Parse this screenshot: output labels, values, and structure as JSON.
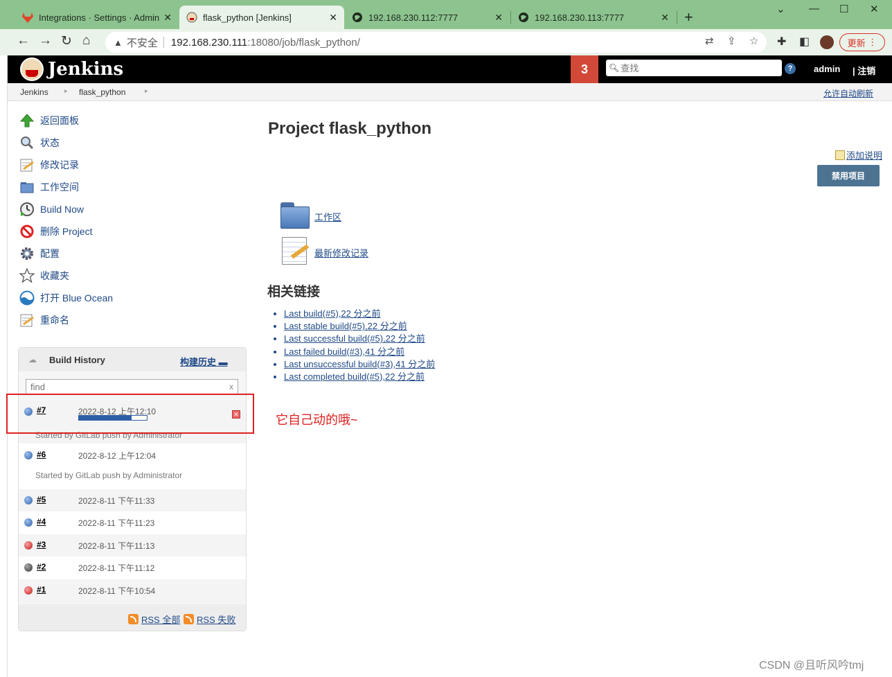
{
  "browser": {
    "tabs": [
      {
        "title": "Integrations · Settings · Admin",
        "icon": "gitlab-icon",
        "active": false
      },
      {
        "title": "flask_python [Jenkins]",
        "icon": "jenkins-icon",
        "active": true
      },
      {
        "title": "192.168.230.112:7777",
        "icon": "globe-icon",
        "active": false
      },
      {
        "title": "192.168.230.113:7777",
        "icon": "globe-icon",
        "active": false
      }
    ],
    "new_tab": "+",
    "address": {
      "security_label": "不安全",
      "host": "192.168.230.111",
      "path": ":18080/job/flask_python/"
    },
    "update_label": "更新"
  },
  "jenkins": {
    "brand": "Jenkins",
    "notifications": "3",
    "search_placeholder": "查找",
    "help": "?",
    "user": "admin",
    "logout": "| 注销",
    "breadcrumbs": [
      "Jenkins",
      "flask_python"
    ],
    "auto_refresh": "允许自动刷新"
  },
  "sidebar": {
    "tasks": [
      {
        "label": "返回面板",
        "icon": "up-arrow-icon"
      },
      {
        "label": "状态",
        "icon": "search-icon"
      },
      {
        "label": "修改记录",
        "icon": "notepad-icon"
      },
      {
        "label": "工作空间",
        "icon": "folder-icon"
      },
      {
        "label": "Build Now",
        "icon": "clock-icon"
      },
      {
        "label": "删除 Project",
        "icon": "no-entry-icon"
      },
      {
        "label": "配置",
        "icon": "gear-icon"
      },
      {
        "label": "收藏夹",
        "icon": "star-icon"
      },
      {
        "label": "打开 Blue Ocean",
        "icon": "blue-ocean-icon"
      },
      {
        "label": "重命名",
        "icon": "notepad-icon"
      }
    ]
  },
  "build_history": {
    "title": "Build History",
    "trend_link": "构建历史 ▬",
    "find_placeholder": "find",
    "find_clear": "x",
    "builds": [
      {
        "num": "#7",
        "date": "2022-8-12 上午12:10",
        "status": "blue",
        "cause": "Started by GitLab push by Administrator",
        "in_progress": true,
        "progress": 0.78
      },
      {
        "num": "#6",
        "date": "2022-8-12 上午12:04",
        "status": "blue",
        "cause": "Started by GitLab push by Administrator"
      },
      {
        "num": "#5",
        "date": "2022-8-11 下午11:33",
        "status": "blue"
      },
      {
        "num": "#4",
        "date": "2022-8-11 下午11:23",
        "status": "blue"
      },
      {
        "num": "#3",
        "date": "2022-8-11 下午11:13",
        "status": "red"
      },
      {
        "num": "#2",
        "date": "2022-8-11 下午11:12",
        "status": "grey"
      },
      {
        "num": "#1",
        "date": "2022-8-11 下午10:54",
        "status": "red"
      }
    ],
    "rss_all": "RSS 全部",
    "rss_failed": "RSS 失败"
  },
  "annotation": "它自己动的哦~",
  "main": {
    "title": "Project flask_python",
    "add_description": "添加说明",
    "disable_button": "禁用项目",
    "workspace_link": "工作区",
    "changes_link": "最新修改记录",
    "related_heading": "相关链接",
    "related_links": [
      "Last build(#5),22 分之前",
      "Last stable build(#5),22 分之前",
      "Last successful build(#5),22 分之前",
      "Last failed build(#3),41 分之前",
      "Last unsuccessful build(#3),41 分之前",
      "Last completed build(#5),22 分之前"
    ]
  },
  "watermark": "CSDN @且听风吟tmj",
  "colors": {
    "accent": "#4c7391",
    "header": "#000000",
    "notify": "#d24939",
    "annotation": "#e02020"
  }
}
